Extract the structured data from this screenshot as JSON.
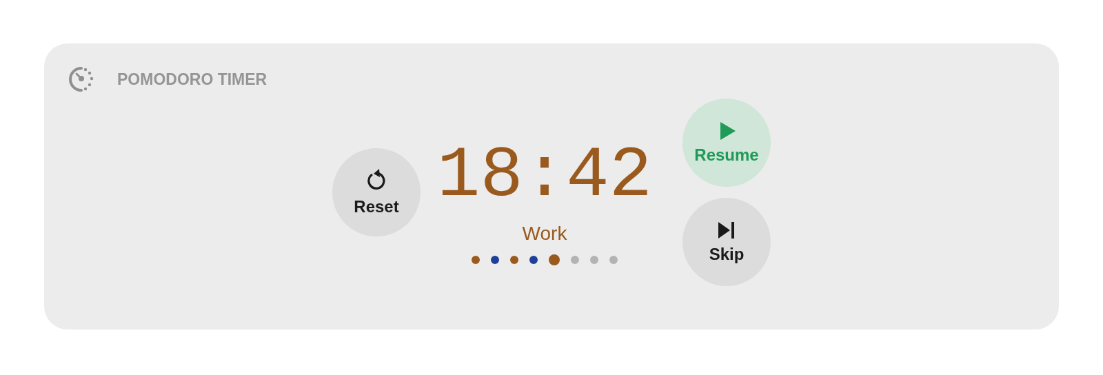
{
  "header": {
    "title": "POMODORO TIMER"
  },
  "timer": {
    "time": "18:42",
    "phase": "Work"
  },
  "sessions": [
    {
      "color": "#9a5a1e",
      "selected": false
    },
    {
      "color": "#1e3f9a",
      "selected": false
    },
    {
      "color": "#9a5a1e",
      "selected": false
    },
    {
      "color": "#1e3f9a",
      "selected": false
    },
    {
      "color": "#9a5a1e",
      "selected": true
    },
    {
      "color": "#b3b3b3",
      "selected": false
    },
    {
      "color": "#b3b3b3",
      "selected": false
    },
    {
      "color": "#b3b3b3",
      "selected": false
    }
  ],
  "buttons": [
    {
      "kind": "reset",
      "label": "Reset"
    },
    {
      "kind": "resume",
      "label": "Resume"
    },
    {
      "kind": "skip",
      "label": "Skip"
    }
  ]
}
